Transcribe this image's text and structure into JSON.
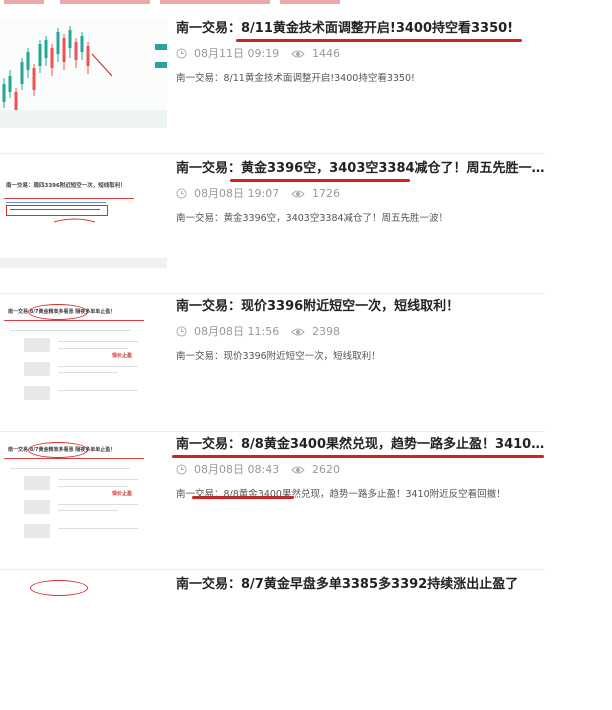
{
  "articles": [
    {
      "title": "南一交易：8/11黄金技术面调整开启!3400持空看3350!",
      "date": "08月11日 09:19",
      "views": "1446",
      "summary": "南一交易：8/11黄金技术面调整开启!3400持空看3350!"
    },
    {
      "title": "南一交易：黄金3396空，3403空3384减仓了！周五先胜一…",
      "date": "08月08日 19:07",
      "views": "1726",
      "summary": "南一交易：黄金3396空，3403空3384减仓了！周五先胜一波！",
      "thumb_text": "南一交易：周四3396附近短空一次，短线取利！"
    },
    {
      "title": "南一交易：现价3396附近短空一次，短线取利！",
      "date": "08月08日 11:56",
      "views": "2398",
      "summary": "南一交易：现价3396附近短空一次，短线取利！",
      "thumb_text": "南一交易 8/7黄金精准多看涨 隔夜多单单止盈！",
      "thumb_note": "现价止盈"
    },
    {
      "title": "南一交易：8/8黄金3400果然兑现，趋势一路多止盈！3410…",
      "date": "08月08日 08:43",
      "views": "2620",
      "summary": "南一交易：8/8黄金3400果然兑现，趋势一路多止盈！3410附近反空看回撤！",
      "thumb_text": "南一交易 8/7黄金精准多看涨 隔夜多单单止盈！",
      "thumb_note": "现价止盈"
    },
    {
      "title": "南一交易：8/7黄金早盘多单3385多3392持续涨出止盈了"
    }
  ],
  "colors": {
    "annotation_red": "#d61f1f",
    "candle_green": "#26a69a",
    "candle_red": "#ef5350"
  },
  "icons": {
    "clock": "clock-icon",
    "eye": "eye-icon"
  }
}
